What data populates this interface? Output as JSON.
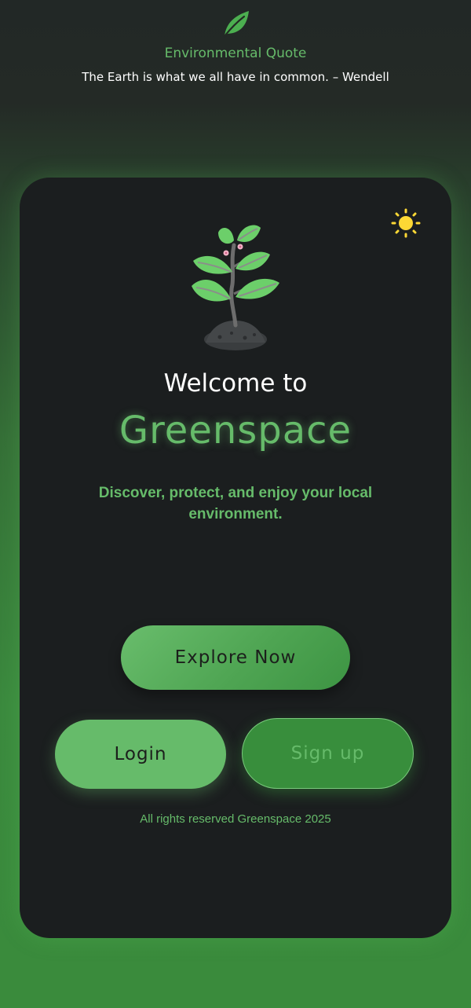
{
  "quote": {
    "title": "Environmental Quote",
    "text": "The Earth is what we all have in common. – Wendell"
  },
  "hero": {
    "welcome": "Welcome to",
    "brand": "Greenspace",
    "tagline": "Discover, protect, and enjoy your local environment."
  },
  "actions": {
    "explore_label": "Explore Now",
    "login_label": "Login",
    "signup_label": "Sign up"
  },
  "footer": {
    "text": "All rights reserved Greenspace 2025"
  },
  "icons": {
    "logo": "leaf-icon",
    "theme_toggle": "sun-icon",
    "illustration": "plant-icon"
  },
  "colors": {
    "accent": "#66bb6a",
    "accent_dark": "#388e3c",
    "card_bg": "#1b1e1f",
    "sun": "#fdd835"
  }
}
